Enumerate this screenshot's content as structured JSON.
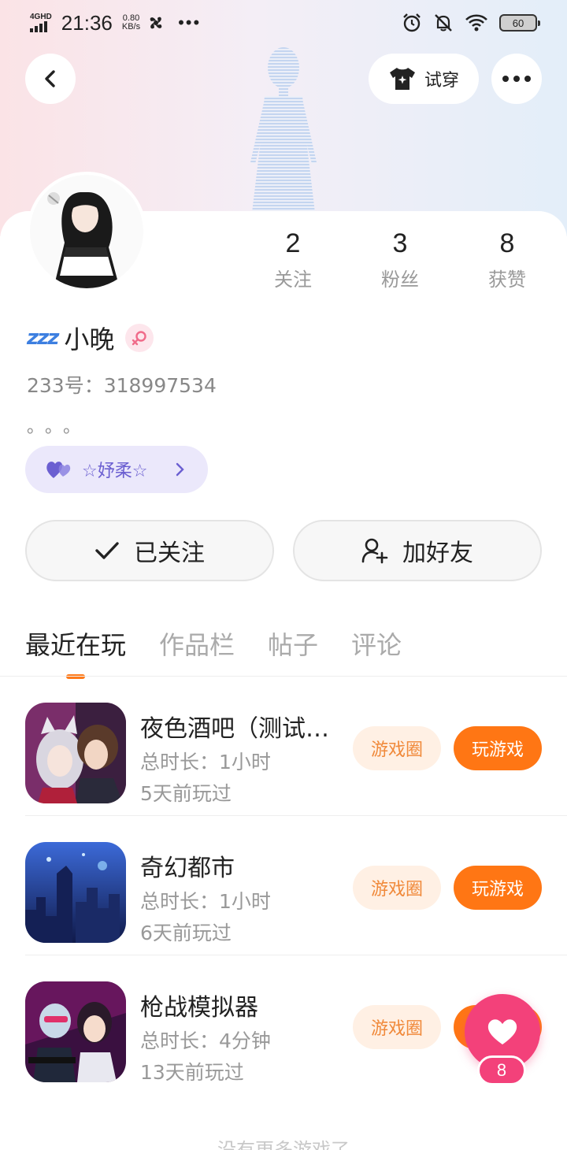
{
  "status_bar": {
    "network": "4GHD",
    "time": "21:36",
    "speed_value": "0.80",
    "speed_unit": "KB/s",
    "more": "•••",
    "battery": "60"
  },
  "header": {
    "tryon_label": "试穿"
  },
  "profile": {
    "nickname": "小晚",
    "zzz": "zzz",
    "uid": "233号：318997534",
    "bio": "。。。",
    "pill_label": "☆妤柔☆"
  },
  "stats": [
    {
      "value": "2",
      "label": "关注"
    },
    {
      "value": "3",
      "label": "粉丝"
    },
    {
      "value": "8",
      "label": "获赞"
    }
  ],
  "actions": {
    "followed_label": "已关注",
    "add_friend_label": "加好友"
  },
  "tabs": [
    {
      "label": "最近在玩",
      "active": true
    },
    {
      "label": "作品栏",
      "active": false
    },
    {
      "label": "帖子",
      "active": false
    },
    {
      "label": "评论",
      "active": false
    }
  ],
  "games": [
    {
      "title": "夜色酒吧（测试…",
      "duration": "总时长：1小时",
      "last_played": "5天前玩过",
      "circle_label": "游戏圈",
      "play_label": "玩游戏"
    },
    {
      "title": "奇幻都市",
      "duration": "总时长：1小时",
      "last_played": "6天前玩过",
      "circle_label": "游戏圈",
      "play_label": "玩游戏"
    },
    {
      "title": "枪战模拟器",
      "duration": "总时长：4分钟",
      "last_played": "13天前玩过",
      "circle_label": "游戏圈",
      "play_label": "玩游戏"
    }
  ],
  "list_end_text": "没有更多游戏了",
  "like_fab": {
    "count": "8"
  },
  "colors": {
    "accent_orange": "#ff7614",
    "like_pink": "#f3417a",
    "pill_purple": "#6b5fd1"
  }
}
